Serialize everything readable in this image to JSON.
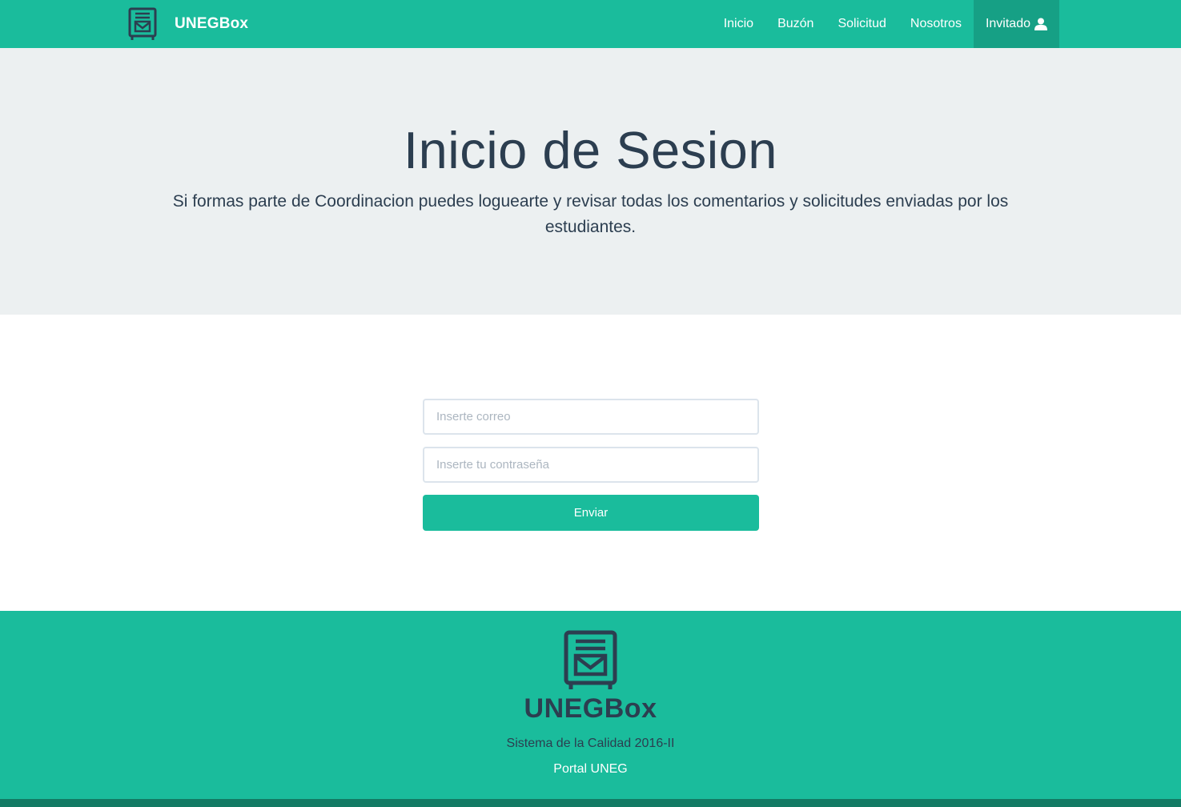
{
  "navbar": {
    "brand": "UNEGBox",
    "items": [
      {
        "label": "Inicio"
      },
      {
        "label": "Buzón"
      },
      {
        "label": "Solicitud"
      },
      {
        "label": "Nosotros"
      }
    ],
    "user": {
      "label": "Invitado",
      "icon": "user-icon"
    }
  },
  "hero": {
    "title": "Inicio de Sesion",
    "description": "Si formas parte de Coordinacion puedes loguearte y revisar todas los comentarios y solicitudes enviadas por los estudiantes."
  },
  "form": {
    "email_placeholder": "Inserte correo",
    "email_value": "",
    "password_placeholder": "Inserte tu contraseña",
    "password_value": "",
    "submit_label": "Enviar"
  },
  "footer": {
    "brand": "UNEGBox",
    "tagline": "Sistema de la Calidad 2016-II",
    "link": "Portal UNEG"
  },
  "colors": {
    "primary": "#1abc9c",
    "primary_dark": "#16a085",
    "text_dark": "#2c3e50",
    "hero_bg": "#ecf0f1"
  }
}
